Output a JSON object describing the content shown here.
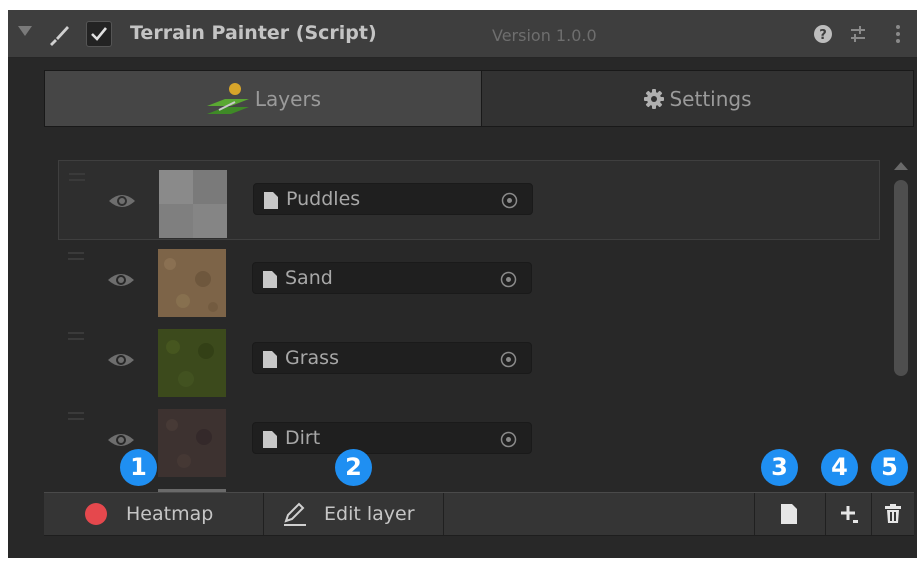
{
  "header": {
    "title": "Terrain Painter (Script)",
    "version": "Version 1.0.0",
    "enabled": true,
    "icons": [
      "fold-arrow-icon",
      "script-brush-icon",
      "checkbox-icon",
      "help-icon",
      "presets-icon",
      "more-options-icon"
    ]
  },
  "tabs": {
    "layers": {
      "label": "Layers",
      "icon": "layers-terrain-icon",
      "active": true
    },
    "settings": {
      "label": "Settings",
      "icon": "gear-icon",
      "active": false
    }
  },
  "layers": [
    {
      "name": "Puddles",
      "thumbnail": "puddles",
      "visible": true
    },
    {
      "name": "Sand",
      "thumbnail": "sand",
      "visible": true
    },
    {
      "name": "Grass",
      "thumbnail": "grass",
      "visible": true
    },
    {
      "name": "Dirt",
      "thumbnail": "dirt",
      "visible": true
    }
  ],
  "toolbar": {
    "heatmap_label": "Heatmap",
    "edit_layer_label": "Edit layer",
    "icons": [
      "record-dot-icon",
      "pencil-icon",
      "new-file-icon",
      "add-layer-icon",
      "trash-icon"
    ]
  },
  "callouts": [
    "1",
    "2",
    "3",
    "4",
    "5"
  ],
  "colors": {
    "callout": "#1f8ff2",
    "record": "#e5484d",
    "panel": "#282828",
    "header": "#3e3e3e"
  }
}
